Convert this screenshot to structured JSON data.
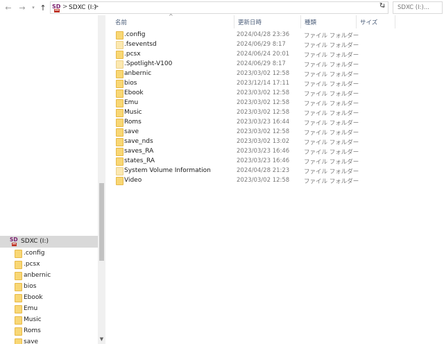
{
  "address_bar": {
    "back_icon": "arrow-left-icon",
    "forward_icon": "arrow-right-icon",
    "recent_icon": "chevron-down-icon",
    "up_icon": "arrow-up-icon",
    "path_separator": ">",
    "path": "SDXC (I:)",
    "refresh_icon": "refresh-icon",
    "search_placeholder": "SDXC (I:)..."
  },
  "columns": {
    "name": "名前",
    "date": "更新日時",
    "type": "種類",
    "size": "サイズ"
  },
  "files": [
    {
      "name": ".config",
      "date": "2024/04/28 23:36",
      "type": "ファイル フォルダー",
      "icon": "folder-icon"
    },
    {
      "name": ".fseventsd",
      "date": "2024/06/29 8:17",
      "type": "ファイル フォルダー",
      "icon": "folder-icon"
    },
    {
      "name": ".pcsx",
      "date": "2024/06/24 20:01",
      "type": "ファイル フォルダー",
      "icon": "folder-icon"
    },
    {
      "name": ".Spotlight-V100",
      "date": "2024/06/29 8:17",
      "type": "ファイル フォルダー",
      "icon": "folder-icon"
    },
    {
      "name": "anbernic",
      "date": "2023/03/02 12:58",
      "type": "ファイル フォルダー",
      "icon": "folder-icon"
    },
    {
      "name": "bios",
      "date": "2023/12/14 17:11",
      "type": "ファイル フォルダー",
      "icon": "folder-icon"
    },
    {
      "name": "Ebook",
      "date": "2023/03/02 12:58",
      "type": "ファイル フォルダー",
      "icon": "folder-icon"
    },
    {
      "name": "Emu",
      "date": "2023/03/02 12:58",
      "type": "ファイル フォルダー",
      "icon": "folder-icon"
    },
    {
      "name": "Music",
      "date": "2023/03/02 12:58",
      "type": "ファイル フォルダー",
      "icon": "folder-icon"
    },
    {
      "name": "Roms",
      "date": "2023/03/23 16:44",
      "type": "ファイル フォルダー",
      "icon": "folder-icon"
    },
    {
      "name": "save",
      "date": "2023/03/02 12:58",
      "type": "ファイル フォルダー",
      "icon": "folder-icon"
    },
    {
      "name": "save_nds",
      "date": "2023/03/02 13:02",
      "type": "ファイル フォルダー",
      "icon": "folder-icon"
    },
    {
      "name": "saves_RA",
      "date": "2023/03/23 16:46",
      "type": "ファイル フォルダー",
      "icon": "folder-icon"
    },
    {
      "name": "states_RA",
      "date": "2023/03/23 16:46",
      "type": "ファイル フォルダー",
      "icon": "folder-icon"
    },
    {
      "name": "System Volume Information",
      "date": "2024/04/28 21:23",
      "type": "ファイル フォルダー",
      "icon": "folder-icon"
    },
    {
      "name": "Video",
      "date": "2023/03/02 12:58",
      "type": "ファイル フォルダー",
      "icon": "folder-icon"
    }
  ],
  "nav": {
    "drive_label": "SDXC (I:)",
    "drive_icon": "sd-card-icon",
    "items": [
      ".config",
      ".pcsx",
      "anbernic",
      "bios",
      "Ebook",
      "Emu",
      "Music",
      "Roms",
      "save"
    ]
  },
  "colors": {
    "folder": "#f8d775",
    "selected_bg": "#d9d9d9",
    "header_text": "#4a5c78"
  }
}
